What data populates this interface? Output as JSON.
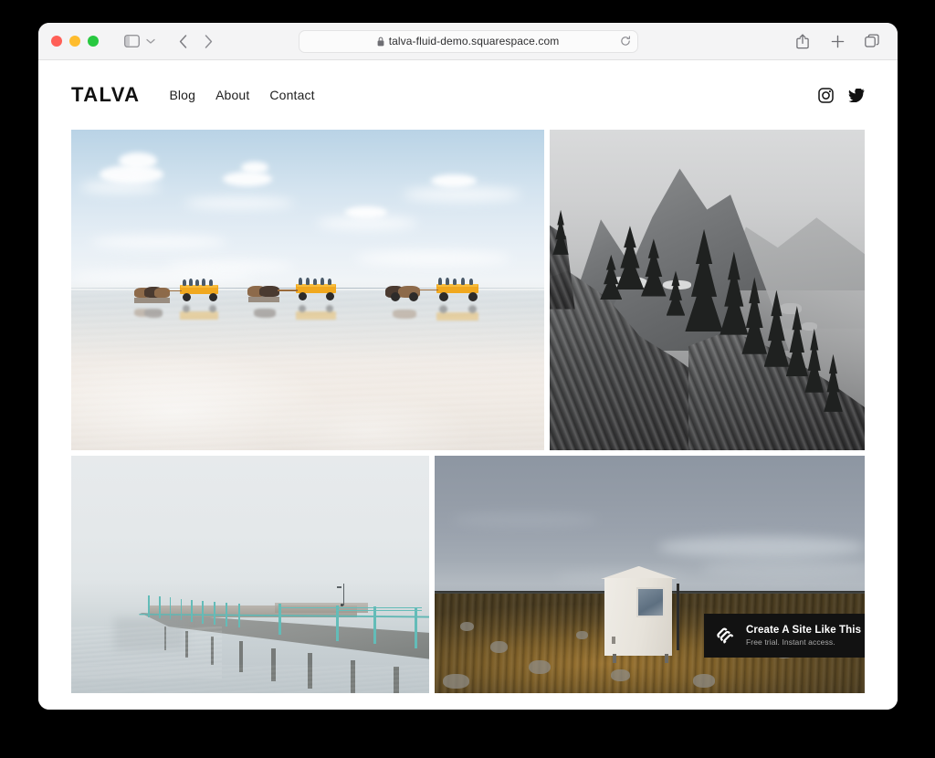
{
  "browser": {
    "traffic_lights": [
      "close",
      "minimize",
      "maximize"
    ],
    "sidebar_icon": "sidebar-icon",
    "chevron_icon": "chevron-down-icon",
    "back_icon": "chevron-left-icon",
    "forward_icon": "chevron-right-icon",
    "address": {
      "lock_icon": "lock-icon",
      "url": "talva-fluid-demo.squarespace.com",
      "reload_icon": "reload-icon"
    },
    "right_actions": [
      {
        "name": "share-icon",
        "label": "Share"
      },
      {
        "name": "new-tab-icon",
        "label": "New Tab"
      },
      {
        "name": "tab-overview-icon",
        "label": "Show Tab Overview"
      }
    ]
  },
  "site": {
    "logo": "TALVA",
    "nav": [
      {
        "label": "Blog"
      },
      {
        "label": "About"
      },
      {
        "label": "Contact"
      }
    ],
    "social": [
      {
        "name": "instagram-icon",
        "label": "Instagram"
      },
      {
        "name": "twitter-icon",
        "label": "Twitter"
      }
    ],
    "gallery": {
      "rows": [
        {
          "items": [
            {
              "name": "gallery-image-horse-carts",
              "alt": "Three horse-drawn orange carts with passengers crossing a reflective tidal flat under a blue sky with scattered clouds"
            },
            {
              "name": "gallery-image-mountain-cliff",
              "alt": "Black and white photograph of a rocky cliff with pine trees and a hazy mountain peak behind"
            }
          ]
        },
        {
          "items": [
            {
              "name": "gallery-image-foggy-pier",
              "alt": "Long concrete pier with turquoise railings vanishing into thick fog over still water"
            },
            {
              "name": "gallery-image-tundra-cabin",
              "alt": "Small white cabin standing alone on golden rocky tundra beneath a heavy gray overcast sky"
            }
          ]
        }
      ]
    }
  },
  "promo": {
    "logo_icon": "squarespace-logo-icon",
    "title": "Create A Site Like This",
    "subtitle": "Free trial. Instant access."
  },
  "colors": {
    "window_bg": "#ffffff",
    "toolbar_bg": "#f4f4f5",
    "promo_bg": "#121212",
    "traffic_close": "#ff5f57",
    "traffic_min": "#febc2e",
    "traffic_max": "#28c840",
    "pier_accent": "#5fb7b4",
    "cart_accent": "#f0a81f"
  }
}
